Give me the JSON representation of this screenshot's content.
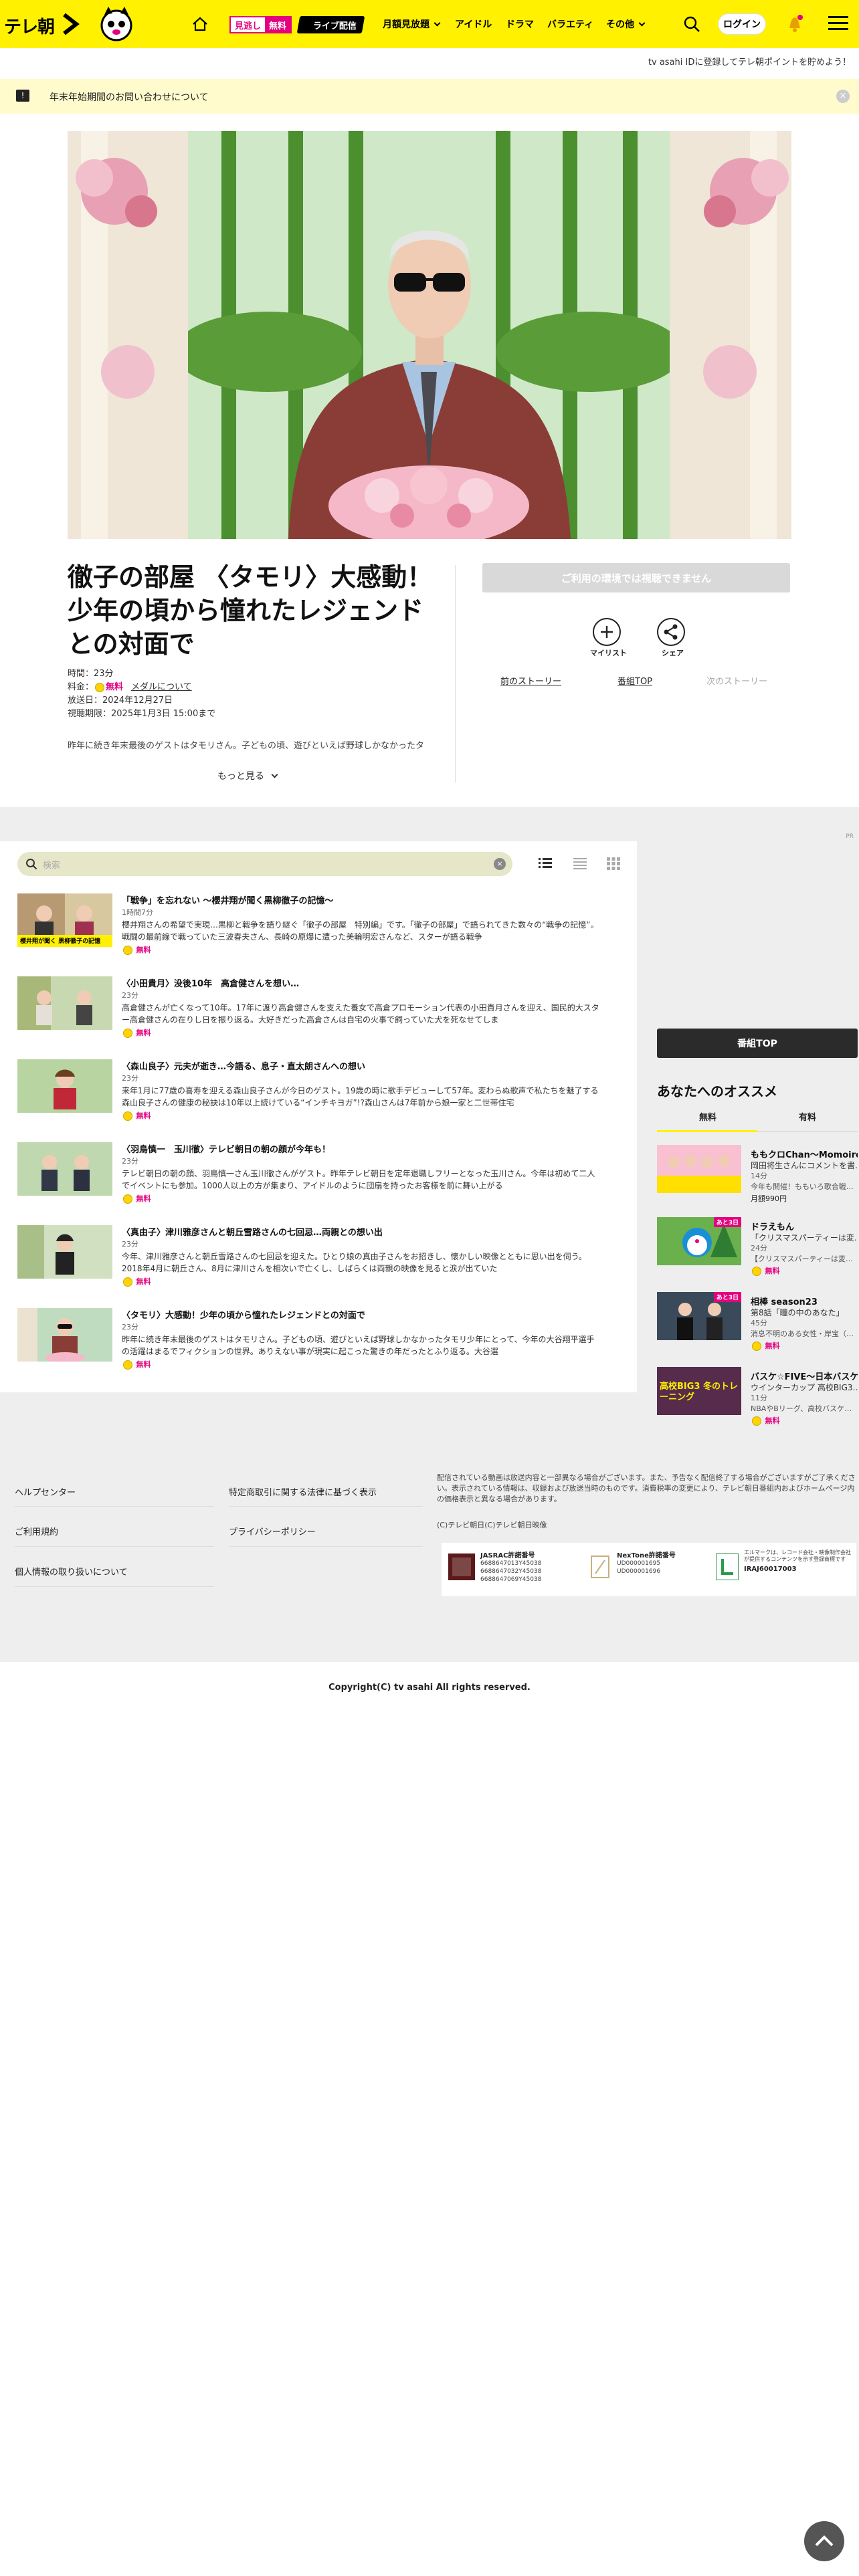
{
  "header": {
    "logo_text": "テレ朝",
    "mini_a": "見逃し",
    "mini_b": "無料",
    "live_label": "ライブ配信",
    "nav": [
      "月額見放題",
      "アイドル",
      "ドラマ",
      "バラエティ",
      "その他"
    ],
    "login_label": "ログイン"
  },
  "sub_bar_text": "tv asahi IDに登録してテレ朝ポイントを貯めよう！",
  "notice_text": "年末年始期間のお問い合わせについて",
  "program": {
    "title": "徹子の部屋 〈タモリ〉大感動！少年の頃から憧れたレジェンドとの対面で",
    "duration": "時間：23分",
    "price_label": "料金：",
    "price_value": "無料",
    "member_link": "メダルについて",
    "air_date": "放送日：2024年12月27日",
    "expiry": "視聴期限：2025年1月3日 15:00まで",
    "description": "昨年に続き年末最後のゲストはタモリさん。子どもの頃、遊びといえば野球しかなかったタ",
    "more_label": "もっと見る",
    "watch_button": "ご利用の環境では視聴できません",
    "mylist_label": "マイリスト",
    "share_label": "シェア",
    "prev_story": "前のストーリー",
    "program_top": "番組TOP",
    "next_story": "次のストーリー"
  },
  "ad_label": "PR",
  "search": {
    "placeholder": "検索"
  },
  "episodes": [
    {
      "title": "「戦争」を忘れない ～櫻井翔が聞く黒柳徹子の記憶～",
      "date": "1時間7分",
      "desc": "櫻井翔さんの希望で実現…黒柳と戦争を語り継ぐ「徹子の部屋　特別編」です。「徹子の部屋」で語られてきた数々の“戦争の記憶”。戦闘の最前線で戦っていた三波春夫さん、長崎の原爆に遭った美輪明宏さんなど、スターが語る戦争",
      "free": "無料",
      "thumb_caption": "櫻井翔が聞く 黒柳徹子の記憶"
    },
    {
      "title": "〈小田貴月〉没後10年　高倉健さんを想い…",
      "date": "23分",
      "desc": "高倉健さんが亡くなって10年。17年に渡り高倉健さんを支えた養女で高倉プロモーション代表の小田貴月さんを迎え、国民的大スター高倉健さんの在りし日を振り返る。大好きだった高倉さんは自宅の火事で飼っていた犬を死なせてしま",
      "free": "無料"
    },
    {
      "title": "〈森山良子〉元夫が逝き…今語る、息子・直太朗さんへの想い",
      "date": "23分",
      "desc": "来年1月に77歳の喜寿を迎える森山良子さんが今日のゲスト。19歳の時に歌手デビューして57年。変わらぬ歌声で私たちを魅了する森山良子さんの健康の秘訣は10年以上続けている“インチキヨガ”!?森山さんは7年前から娘一家と二世帯住宅",
      "free": "無料"
    },
    {
      "title": "〈羽鳥慎一　玉川徹〉テレビ朝日の朝の顔が今年も！",
      "date": "23分",
      "desc": "テレビ朝日の朝の顔、羽鳥慎一さん玉川徹さんがゲスト。昨年テレビ朝日を定年退職しフリーとなった玉川さん。今年は初めて二人でイベントにも参加。1000人以上の方が集まり、アイドルのように団扇を持ったお客様を前に舞い上がる",
      "free": "無料"
    },
    {
      "title": "〈真由子〉津川雅彦さんと朝丘雪路さんの七回忌…両親との想い出",
      "date": "23分",
      "desc": "今年、津川雅彦さんと朝丘雪路さんの七回忌を迎えた。ひとり娘の真由子さんをお招きし、懐かしい映像とともに思い出を伺う。2018年4月に朝丘さん、8月に津川さんを相次いで亡くし、しばらくは両親の映像を見ると涙が出ていた",
      "free": "無料"
    },
    {
      "title": "〈タモリ〉大感動！少年の頃から憧れたレジェンドとの対面で",
      "date": "23分",
      "desc": "昨年に続き年末最後のゲストはタモリさん。子どもの頃、遊びといえば野球しかなかったタモリ少年にとって、今年の大谷翔平選手の活躍はまるでフィクションの世界。ありえない事が現実に起こった驚きの年だったとふり返る。大谷選",
      "free": "無料"
    }
  ],
  "right_col": {
    "program_top": "番組TOP",
    "rec_title": "あなたへのオススメ",
    "tab_free": "無料",
    "tab_paid": "有料",
    "recs": [
      {
        "title": "ももクロChan～Momoiro Clover Z Channel～",
        "sub": "岡田将生さんにコメントを書…",
        "dur": "14分",
        "extra": "今年も開催！ももいろ歌合戦…",
        "price": "月額990円",
        "thumb_label": ""
      },
      {
        "title": "ドラえもん",
        "sub": "「クリスマスパーティーは変…",
        "dur": "24分",
        "extra": "【クリスマスパーティーは変…",
        "price": "無料",
        "thumb_label": "あと3日"
      },
      {
        "title": "相棒 season23",
        "sub": "第8話「瞳の中のあなた」",
        "dur": "45分",
        "extra": "消息不明のある女性・岸宝（…",
        "price": "無料",
        "thumb_label": "あと3日"
      },
      {
        "title": "バスケ☆FIVE～日本バスケ最前線～",
        "sub": "ウインターカップ 高校BIG3…",
        "dur": "11分",
        "extra": "NBAやBリーグ、高校バスケ…",
        "price": "無料",
        "thumb_label": "高校BIG3 冬のトレーニング"
      }
    ]
  },
  "footer": {
    "left_links": [
      "ヘルプセンター",
      "ご利用規約",
      "個人情報の取り扱いについて"
    ],
    "mid_links": [
      "特定商取引に関する法律に基づく表示",
      "プライバシーポリシー"
    ],
    "info": "配信されている動画は放送内容と一部異なる場合がございます。また、予告なく配信終了する場合がございますがご了承ください。表示されている情報は、収録および放送当時のものです。消費税率の変更により、テレビ朝日番組内およびホームページ内の価格表示と異なる場合があります。",
    "small_copy": "(C)テレビ朝日(C)テレビ朝日映像",
    "jasrac_label": "JASRAC許諾番号",
    "jasrac_nums": [
      "6688647013Y45038",
      "6688647032Y45038",
      "6688647069Y45038"
    ],
    "nextone_label": "NexTone許諾番号",
    "nextone_nums": [
      "UD000001695",
      "UD000001696"
    ],
    "lmark_text": "エルマークは、レコード会社・映像制作会社が提供するコンテンツを示す登録商標です",
    "lmark_num": "IRAJ60017003",
    "copyright": "Copyright(C) tv asahi All rights reserved."
  }
}
